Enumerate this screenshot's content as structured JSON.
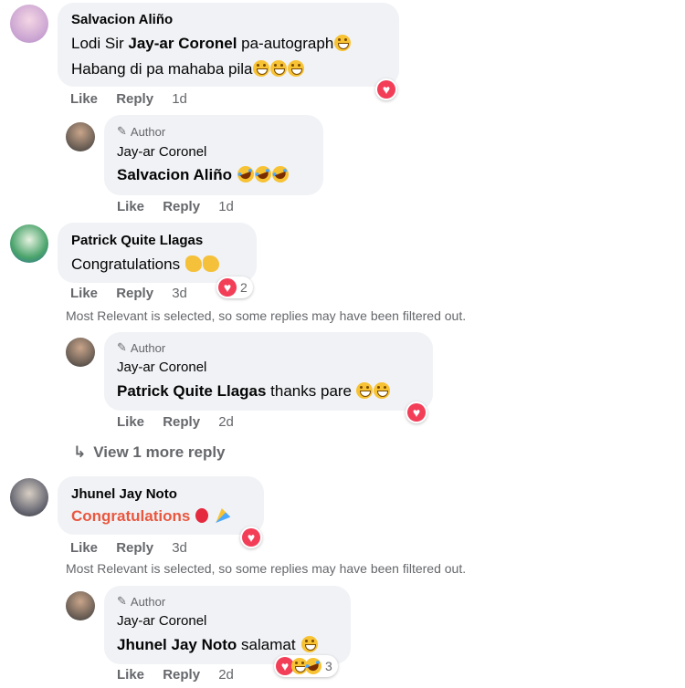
{
  "threads": [
    {
      "commenter": "Salvacion Aliño",
      "text_plain": "Lodi Sir ",
      "text_mention": "Jay-ar Coronel",
      "text_after": " pa-autograph",
      "text_line2": "Habang di pa mahaba pila",
      "like": "Like",
      "reply": "Reply",
      "time": "1d",
      "reply_item": {
        "author_badge": "Author",
        "name": "Jay-ar Coronel",
        "mention": "Salvacion Aliño",
        "text": "",
        "like": "Like",
        "reply": "Reply",
        "time": "1d"
      }
    },
    {
      "commenter": "Patrick Quite Llagas",
      "text": "Congratulations",
      "like": "Like",
      "reply": "Reply",
      "time": "3d",
      "reaction_count": "2",
      "filter_note": "Most Relevant is selected, so some replies may have been filtered out.",
      "reply_item": {
        "author_badge": "Author",
        "name": "Jay-ar Coronel",
        "mention": "Patrick Quite Llagas",
        "text": " thanks pare",
        "like": "Like",
        "reply": "Reply",
        "time": "2d"
      },
      "view_more": "View 1 more reply"
    },
    {
      "commenter": "Jhunel Jay Noto",
      "text": "Congratulations",
      "like": "Like",
      "reply": "Reply",
      "time": "3d",
      "filter_note": "Most Relevant is selected, so some replies may have been filtered out.",
      "reply_item": {
        "author_badge": "Author",
        "name": "Jay-ar Coronel",
        "mention": "Jhunel Jay Noto",
        "text": " salamat",
        "like": "Like",
        "reply": "Reply",
        "time": "2d",
        "reaction_count": "3"
      }
    }
  ],
  "colors": {
    "bubble": "#f0f2f5",
    "meta": "#65676b",
    "heart": "#f33e58",
    "congrats": "#e9573f"
  }
}
